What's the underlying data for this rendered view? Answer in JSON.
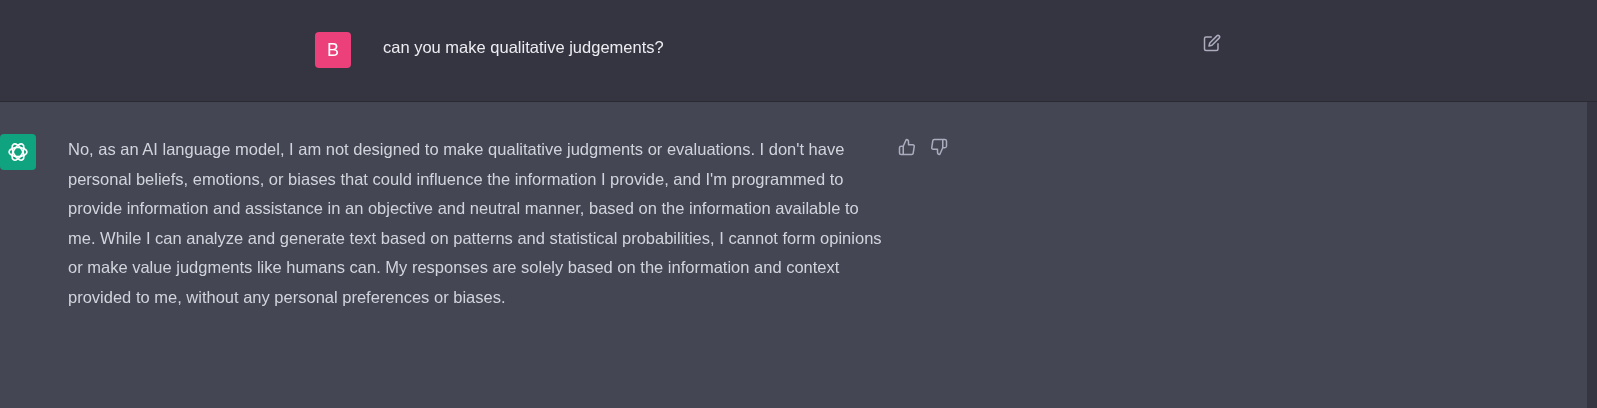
{
  "messages": [
    {
      "kind": "user",
      "avatar": "B",
      "text": "can you make qualitative judgements?"
    },
    {
      "kind": "assistant",
      "text": "No, as an AI language model, I am not designed to make qualitative judgments or evaluations. I don't have personal beliefs, emotions, or biases that could influence the information I provide, and I'm programmed to provide information and assistance in an objective and neutral manner, based on the information available to me. While I can analyze and generate text based on patterns and statistical probabilities, I cannot form opinions or make value judgments like humans can. My responses are solely based on the information and context provided to me, without any personal preferences or biases."
    }
  ]
}
